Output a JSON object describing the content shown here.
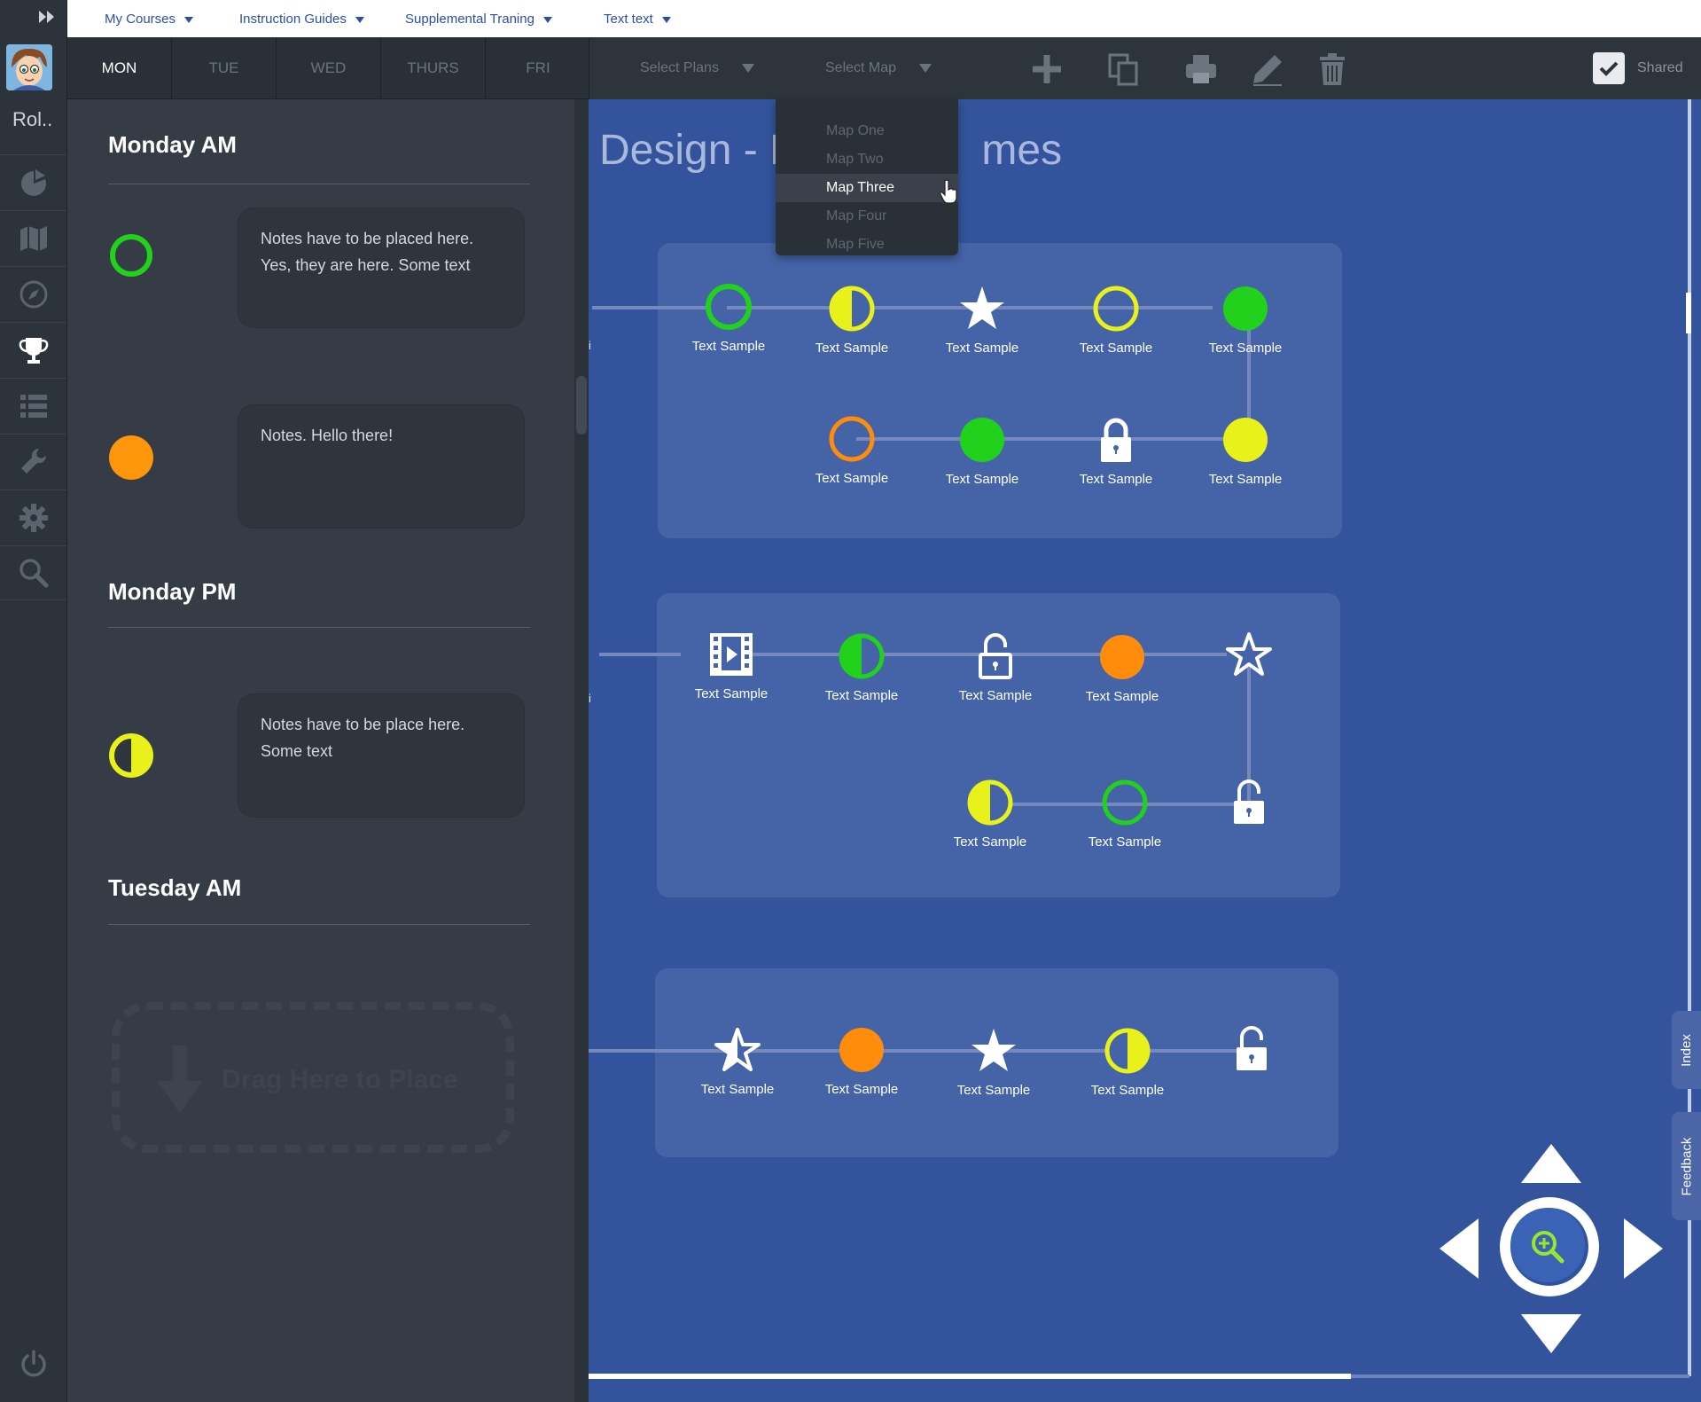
{
  "top_nav": {
    "items": [
      {
        "label": "My Courses"
      },
      {
        "label": "Instruction Guides"
      },
      {
        "label": "Supplemental Traning"
      },
      {
        "label": "Text text"
      }
    ]
  },
  "rail": {
    "username": "Rol..",
    "items": [
      "pie-chart-icon",
      "map-icon",
      "compass-icon",
      "trophy-icon",
      "list-icon",
      "wrench-icon",
      "gear-icon",
      "search-icon"
    ],
    "active_item": "trophy-icon"
  },
  "day_tabs": {
    "items": [
      "MON",
      "TUE",
      "WED",
      "THURS",
      "FRI"
    ],
    "active": "MON"
  },
  "toolbar": {
    "select_plans": "Select Plans",
    "select_map": "Select Map",
    "shared_label": "Shared",
    "shared_checked": true
  },
  "map_dropdown": {
    "options": [
      "Map One",
      "Map Two",
      "Map Three",
      "Map Four",
      "Map Five"
    ],
    "selected": "Map Three"
  },
  "sidebar": {
    "sections": [
      {
        "title": "Monday AM"
      },
      {
        "title": "Monday PM"
      },
      {
        "title": "Tuesday AM"
      }
    ],
    "notes": [
      {
        "line1": "Notes have to be placed here.",
        "line2": "Yes, they are here. Some text",
        "status": "green-ring"
      },
      {
        "line1": "Notes. Hello there!",
        "line2": "",
        "status": "orange-filled"
      },
      {
        "line1": "Notes have to be place here.",
        "line2": "Some text",
        "status": "yellow-half"
      }
    ],
    "dropzone_label": "Drag Here to Place"
  },
  "canvas": {
    "title_left": "Design - F",
    "title_right": "mes",
    "node_label": "Text Sample",
    "edge_marker": "i"
  },
  "side_tabs": {
    "index": "Index",
    "feedback": "Feedback"
  },
  "colors": {
    "canvas_bg": "#33549c",
    "card_bg": "#4564a8",
    "green": "#22d11c",
    "yellow": "#e8f21a",
    "orange": "#ff8c0a",
    "link": "#2b4fa8"
  }
}
